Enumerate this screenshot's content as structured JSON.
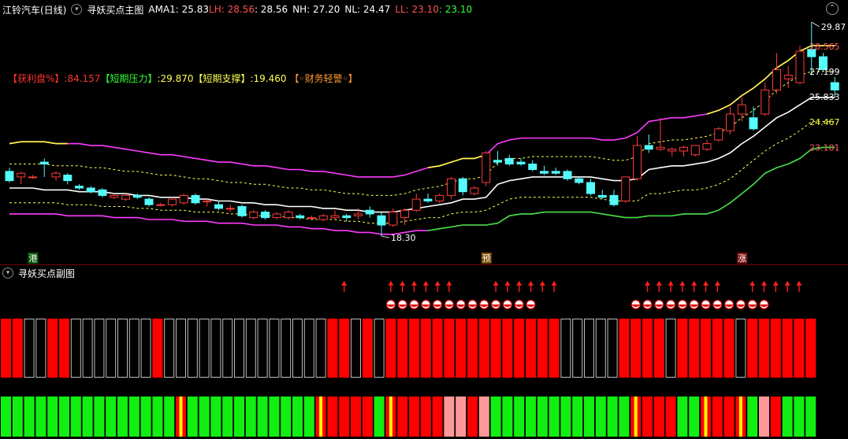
{
  "main_header": {
    "title": "江铃汽车(日线)",
    "indicator": "寻妖买点主图",
    "ama1_label": "AMA1: ",
    "ama1_value": "25.83",
    "lh_label": "LH: ",
    "lh_value": "28.56",
    "lh_value2": ": 28.56",
    "nh_label": "NH: ",
    "nh_value": "27.20",
    "nl_label": "NL: ",
    "nl_value": "24.47",
    "ll_label": "LL: ",
    "ll_value": "23.10",
    "ll_value2": ": 23.10"
  },
  "info_line": {
    "profit_label": "【获利盘%】",
    "profit_value": ":84.157",
    "resist_label": "【短期压力】",
    "resist_value": ":29.870",
    "support_label": "【短期支撑】",
    "support_value": ":19.460",
    "finance_label": "【◦财务轻警◦】"
  },
  "sub_header": {
    "title": "寻妖买点副图"
  },
  "colors": {
    "up": "#ff3b3b",
    "down": "#54fcfc",
    "upper_band": "#ff3cff",
    "lower_band": "#ff3cff",
    "mid": "#ffffff",
    "dash": "#ffff55",
    "yellow_hi": "#ffff40",
    "green_lo": "#33dd33",
    "bar_red": "#ff0000",
    "bar_green": "#11ee11",
    "bar_pink": "#ff9999"
  },
  "chart_data": [
    {
      "type": "candlestick",
      "title": "寻妖买点主图",
      "ylim": [
        17.2,
        30.3
      ],
      "high_label": "29.87",
      "low_label": "18.30",
      "right_labels": [
        {
          "text": "28.565",
          "value": 28.565,
          "color": "#ff6060"
        },
        {
          "text": "27.199",
          "value": 27.199,
          "color": "#ffffff"
        },
        {
          "text": "25.833",
          "value": 25.833,
          "color": "#ffffff"
        },
        {
          "text": "24.467",
          "value": 24.467,
          "color": "#ffff40"
        },
        {
          "text": "23.101",
          "value": 23.101,
          "color": "#ff6060"
        }
      ],
      "markers": [
        {
          "index": 2,
          "text": "港",
          "bg": "#0a5a0a",
          "color": "#ffffff"
        },
        {
          "index": 41,
          "text": "预",
          "bg": "#7a4a00",
          "color": "#ffffff"
        },
        {
          "index": 63,
          "text": "涨",
          "bg": "#7a1010",
          "color": "#ffffff"
        }
      ],
      "candles": [
        {
          "o": 21.8,
          "h": 22.0,
          "l": 21.2,
          "c": 21.3
        },
        {
          "o": 21.5,
          "h": 21.8,
          "l": 21.1,
          "c": 21.7
        },
        {
          "o": 21.5,
          "h": 21.6,
          "l": 21.4,
          "c": 21.5
        },
        {
          "o": 22.3,
          "h": 22.5,
          "l": 21.5,
          "c": 22.2
        },
        {
          "o": 21.5,
          "h": 21.8,
          "l": 21.3,
          "c": 21.7
        },
        {
          "o": 21.6,
          "h": 21.7,
          "l": 21.1,
          "c": 21.3
        },
        {
          "o": 21.0,
          "h": 21.1,
          "l": 20.8,
          "c": 20.9
        },
        {
          "o": 20.9,
          "h": 21.0,
          "l": 20.6,
          "c": 20.7
        },
        {
          "o": 20.8,
          "h": 20.9,
          "l": 20.4,
          "c": 20.5
        },
        {
          "o": 20.4,
          "h": 20.6,
          "l": 20.3,
          "c": 20.5
        },
        {
          "o": 20.3,
          "h": 20.6,
          "l": 20.2,
          "c": 20.5
        },
        {
          "o": 20.5,
          "h": 20.6,
          "l": 20.3,
          "c": 20.4
        },
        {
          "o": 20.3,
          "h": 20.4,
          "l": 19.9,
          "c": 20.0
        },
        {
          "o": 20.0,
          "h": 20.1,
          "l": 19.9,
          "c": 20.0
        },
        {
          "o": 20.0,
          "h": 20.4,
          "l": 19.9,
          "c": 20.3
        },
        {
          "o": 20.1,
          "h": 20.6,
          "l": 20.0,
          "c": 20.5
        },
        {
          "o": 20.5,
          "h": 20.6,
          "l": 20.0,
          "c": 20.1
        },
        {
          "o": 20.2,
          "h": 20.3,
          "l": 19.9,
          "c": 20.2
        },
        {
          "o": 20.0,
          "h": 20.2,
          "l": 19.7,
          "c": 19.8
        },
        {
          "o": 19.8,
          "h": 20.0,
          "l": 19.6,
          "c": 19.8
        },
        {
          "o": 19.9,
          "h": 20.0,
          "l": 19.3,
          "c": 19.4
        },
        {
          "o": 19.3,
          "h": 19.7,
          "l": 19.2,
          "c": 19.6
        },
        {
          "o": 19.6,
          "h": 19.7,
          "l": 19.2,
          "c": 19.3
        },
        {
          "o": 19.3,
          "h": 19.6,
          "l": 19.2,
          "c": 19.5
        },
        {
          "o": 19.3,
          "h": 19.7,
          "l": 19.2,
          "c": 19.6
        },
        {
          "o": 19.4,
          "h": 19.5,
          "l": 19.2,
          "c": 19.3
        },
        {
          "o": 19.3,
          "h": 19.4,
          "l": 19.2,
          "c": 19.3
        },
        {
          "o": 19.2,
          "h": 19.5,
          "l": 19.1,
          "c": 19.4
        },
        {
          "o": 19.3,
          "h": 19.7,
          "l": 19.2,
          "c": 19.4
        },
        {
          "o": 19.4,
          "h": 19.5,
          "l": 19.1,
          "c": 19.3
        },
        {
          "o": 19.4,
          "h": 19.8,
          "l": 19.2,
          "c": 19.5
        },
        {
          "o": 19.7,
          "h": 19.9,
          "l": 19.3,
          "c": 19.5
        },
        {
          "o": 19.4,
          "h": 19.6,
          "l": 18.3,
          "c": 18.9
        },
        {
          "o": 18.9,
          "h": 19.8,
          "l": 18.8,
          "c": 19.6
        },
        {
          "o": 19.3,
          "h": 19.8,
          "l": 18.9,
          "c": 19.7
        },
        {
          "o": 19.7,
          "h": 20.6,
          "l": 19.6,
          "c": 20.3
        },
        {
          "o": 20.3,
          "h": 20.6,
          "l": 20.1,
          "c": 20.2
        },
        {
          "o": 20.2,
          "h": 20.6,
          "l": 20.1,
          "c": 20.5
        },
        {
          "o": 20.5,
          "h": 21.5,
          "l": 20.3,
          "c": 21.4
        },
        {
          "o": 21.4,
          "h": 21.5,
          "l": 20.5,
          "c": 20.7
        },
        {
          "o": 20.6,
          "h": 21.0,
          "l": 20.5,
          "c": 20.9
        },
        {
          "o": 21.2,
          "h": 22.9,
          "l": 21.0,
          "c": 22.8
        },
        {
          "o": 22.4,
          "h": 22.9,
          "l": 22.1,
          "c": 22.3
        },
        {
          "o": 22.5,
          "h": 22.7,
          "l": 22.1,
          "c": 22.2
        },
        {
          "o": 22.3,
          "h": 22.5,
          "l": 22.1,
          "c": 22.2
        },
        {
          "o": 22.2,
          "h": 22.4,
          "l": 21.8,
          "c": 21.9
        },
        {
          "o": 21.8,
          "h": 22.1,
          "l": 21.6,
          "c": 21.7
        },
        {
          "o": 21.8,
          "h": 22.0,
          "l": 21.6,
          "c": 21.7
        },
        {
          "o": 21.8,
          "h": 21.9,
          "l": 21.3,
          "c": 21.4
        },
        {
          "o": 21.4,
          "h": 21.5,
          "l": 21.1,
          "c": 21.2
        },
        {
          "o": 21.2,
          "h": 21.4,
          "l": 20.5,
          "c": 20.6
        },
        {
          "o": 20.5,
          "h": 20.8,
          "l": 20.3,
          "c": 20.4
        },
        {
          "o": 20.5,
          "h": 20.8,
          "l": 19.9,
          "c": 20.0
        },
        {
          "o": 20.2,
          "h": 21.5,
          "l": 20.1,
          "c": 21.5
        },
        {
          "o": 21.4,
          "h": 23.7,
          "l": 21.3,
          "c": 23.2
        },
        {
          "o": 23.2,
          "h": 23.8,
          "l": 22.8,
          "c": 23.0
        },
        {
          "o": 23.0,
          "h": 24.7,
          "l": 22.9,
          "c": 23.1
        },
        {
          "o": 22.9,
          "h": 23.1,
          "l": 22.6,
          "c": 23.0
        },
        {
          "o": 22.9,
          "h": 23.2,
          "l": 22.6,
          "c": 23.1
        },
        {
          "o": 22.7,
          "h": 23.2,
          "l": 22.6,
          "c": 23.2
        },
        {
          "o": 23.0,
          "h": 23.5,
          "l": 22.9,
          "c": 23.3
        },
        {
          "o": 23.5,
          "h": 24.2,
          "l": 23.4,
          "c": 24.1
        },
        {
          "o": 24.0,
          "h": 25.3,
          "l": 23.8,
          "c": 24.9
        },
        {
          "o": 24.9,
          "h": 25.8,
          "l": 24.5,
          "c": 25.4
        },
        {
          "o": 24.7,
          "h": 25.3,
          "l": 24.0,
          "c": 24.1
        },
        {
          "o": 24.9,
          "h": 26.6,
          "l": 24.8,
          "c": 26.2
        },
        {
          "o": 26.2,
          "h": 28.2,
          "l": 26.0,
          "c": 27.3
        },
        {
          "o": 26.8,
          "h": 27.5,
          "l": 26.3,
          "c": 27.0
        },
        {
          "o": 26.6,
          "h": 28.6,
          "l": 26.5,
          "c": 28.3
        },
        {
          "o": 28.4,
          "h": 29.87,
          "l": 27.0,
          "c": 28.0
        },
        {
          "o": 28.0,
          "h": 28.2,
          "l": 27.2,
          "c": 27.3
        },
        {
          "o": 26.6,
          "h": 26.9,
          "l": 25.8,
          "c": 26.2
        }
      ],
      "upper_band": [
        23.3,
        23.4,
        23.4,
        23.4,
        23.3,
        23.3,
        23.3,
        23.2,
        23.2,
        23.1,
        23.0,
        22.9,
        22.8,
        22.7,
        22.7,
        22.6,
        22.5,
        22.4,
        22.3,
        22.3,
        22.2,
        22.1,
        22.1,
        22.0,
        21.9,
        21.9,
        21.8,
        21.8,
        21.7,
        21.6,
        21.5,
        21.5,
        21.5,
        21.5,
        21.6,
        21.8,
        22.0,
        22.1,
        22.3,
        22.5,
        22.5,
        22.7,
        23.3,
        23.5,
        23.6,
        23.6,
        23.6,
        23.6,
        23.6,
        23.6,
        23.6,
        23.5,
        23.5,
        23.6,
        23.9,
        24.5,
        24.6,
        24.7,
        24.7,
        24.8,
        24.9,
        25.1,
        25.4,
        25.9,
        26.3,
        26.8,
        27.4,
        27.8,
        28.3,
        28.6,
        28.6,
        28.6
      ],
      "lower_band": [
        19.5,
        19.5,
        19.5,
        19.5,
        19.5,
        19.4,
        19.4,
        19.4,
        19.4,
        19.3,
        19.3,
        19.3,
        19.2,
        19.2,
        19.2,
        19.1,
        19.1,
        19.1,
        19.0,
        19.0,
        19.0,
        18.9,
        18.9,
        18.9,
        18.8,
        18.8,
        18.7,
        18.7,
        18.6,
        18.6,
        18.5,
        18.5,
        18.4,
        18.4,
        18.5,
        18.6,
        18.6,
        18.7,
        18.8,
        18.9,
        18.9,
        18.9,
        19.0,
        19.4,
        19.5,
        19.5,
        19.6,
        19.6,
        19.6,
        19.6,
        19.6,
        19.5,
        19.4,
        19.3,
        19.3,
        19.4,
        19.4,
        19.4,
        19.5,
        19.5,
        19.5,
        19.7,
        20.1,
        20.6,
        21.1,
        21.7,
        22.0,
        22.2,
        22.5,
        23.0,
        23.1,
        23.1
      ],
      "mid_line": [
        20.9,
        20.9,
        20.9,
        20.8,
        20.8,
        20.8,
        20.7,
        20.7,
        20.7,
        20.6,
        20.6,
        20.5,
        20.5,
        20.4,
        20.4,
        20.4,
        20.3,
        20.3,
        20.2,
        20.2,
        20.1,
        20.1,
        20.0,
        20.0,
        19.9,
        19.9,
        19.9,
        19.8,
        19.8,
        19.7,
        19.7,
        19.6,
        19.6,
        19.6,
        19.7,
        19.8,
        19.9,
        20.0,
        20.1,
        20.3,
        20.3,
        20.4,
        21.1,
        21.3,
        21.4,
        21.5,
        21.5,
        21.5,
        21.5,
        21.5,
        21.5,
        21.4,
        21.3,
        21.3,
        21.4,
        21.9,
        22.0,
        22.1,
        22.1,
        22.2,
        22.3,
        22.5,
        22.8,
        23.3,
        23.7,
        24.2,
        24.7,
        25.0,
        25.4,
        25.8,
        25.8,
        25.8
      ],
      "dash_line": [
        22.2,
        22.2,
        22.2,
        22.2,
        22.1,
        22.1,
        22.1,
        22.0,
        22.0,
        21.9,
        21.8,
        21.8,
        21.7,
        21.6,
        21.6,
        21.5,
        21.4,
        21.4,
        21.3,
        21.2,
        21.2,
        21.1,
        21.1,
        21.0,
        20.9,
        20.9,
        20.8,
        20.8,
        20.7,
        20.6,
        20.6,
        20.5,
        20.5,
        20.5,
        20.6,
        20.8,
        20.9,
        21.0,
        21.2,
        21.4,
        21.4,
        21.6,
        22.3,
        22.5,
        22.5,
        22.6,
        22.6,
        22.6,
        22.6,
        22.6,
        22.6,
        22.5,
        22.4,
        22.4,
        22.6,
        23.3,
        23.4,
        23.5,
        23.5,
        23.6,
        23.7,
        23.9,
        24.2,
        24.7,
        25.1,
        25.6,
        26.2,
        26.6,
        27.0,
        27.2,
        27.2,
        27.2
      ],
      "dash_line_low": [
        20.1,
        20.1,
        20.1,
        20.1,
        20.1,
        20.0,
        20.0,
        20.0,
        19.9,
        19.9,
        19.9,
        19.8,
        19.8,
        19.7,
        19.7,
        19.7,
        19.6,
        19.6,
        19.6,
        19.5,
        19.5,
        19.4,
        19.4,
        19.4,
        19.3,
        19.3,
        19.2,
        19.2,
        19.2,
        19.1,
        19.1,
        19.0,
        19.0,
        19.0,
        19.1,
        19.2,
        19.3,
        19.3,
        19.5,
        19.6,
        19.6,
        19.7,
        20.0,
        20.3,
        20.4,
        20.4,
        20.4,
        20.4,
        20.4,
        20.4,
        20.4,
        20.3,
        20.2,
        20.2,
        20.2,
        20.6,
        20.6,
        20.7,
        20.8,
        20.8,
        20.9,
        21.1,
        21.4,
        21.9,
        22.4,
        22.9,
        23.3,
        23.6,
        24.0,
        24.5,
        24.5,
        24.5
      ],
      "yellow_hi_segments": [
        [
          0,
          5
        ],
        [
          36,
          41
        ],
        [
          60,
          71
        ]
      ],
      "green_lo_segments": [
        [
          36,
          71
        ]
      ]
    },
    {
      "type": "signal",
      "title": "寻妖买点副图",
      "arrows_up": [
        29,
        33,
        34,
        35,
        36,
        37,
        38,
        42,
        43,
        44,
        45,
        46,
        47,
        55,
        56,
        57,
        58,
        59,
        60,
        61,
        64,
        65,
        66,
        67,
        68
      ],
      "balls": [
        33,
        34,
        35,
        36,
        37,
        38,
        39,
        40,
        41,
        42,
        43,
        44,
        45,
        54,
        55,
        56,
        57,
        58,
        59,
        60,
        61,
        62,
        63,
        64,
        65
      ],
      "upper_bars": [
        "R",
        "R",
        "B",
        "B",
        "R",
        "R",
        "B",
        "B",
        "B",
        "B",
        "B",
        "B",
        "B",
        "R",
        "B",
        "B",
        "B",
        "B",
        "B",
        "B",
        "B",
        "B",
        "B",
        "B",
        "B",
        "B",
        "B",
        "B",
        "R",
        "R",
        "B",
        "R",
        "B",
        "R",
        "R",
        "R",
        "R",
        "R",
        "R",
        "R",
        "R",
        "R",
        "R",
        "R",
        "R",
        "R",
        "R",
        "R",
        "B",
        "B",
        "B",
        "B",
        "B",
        "R",
        "R",
        "R",
        "R",
        "B",
        "R",
        "R",
        "R",
        "R",
        "R",
        "B",
        "R",
        "R",
        "R",
        "R",
        "R",
        "R"
      ],
      "lower_bars": [
        "G",
        "G",
        "G",
        "G",
        "G",
        "G",
        "G",
        "G",
        "G",
        "G",
        "G",
        "G",
        "G",
        "G",
        "G",
        "Y",
        "G",
        "G",
        "G",
        "G",
        "G",
        "G",
        "G",
        "G",
        "G",
        "G",
        "G",
        "Y",
        "R",
        "R",
        "R",
        "R",
        "G",
        "Y",
        "R",
        "R",
        "R",
        "R",
        "P",
        "P",
        "R",
        "P",
        "G",
        "G",
        "G",
        "G",
        "G",
        "G",
        "G",
        "G",
        "G",
        "G",
        "G",
        "G",
        "Y",
        "R",
        "R",
        "R",
        "G",
        "G",
        "Y",
        "R",
        "R",
        "Y",
        "G",
        "P",
        "R",
        "G",
        "G",
        "G"
      ]
    }
  ]
}
